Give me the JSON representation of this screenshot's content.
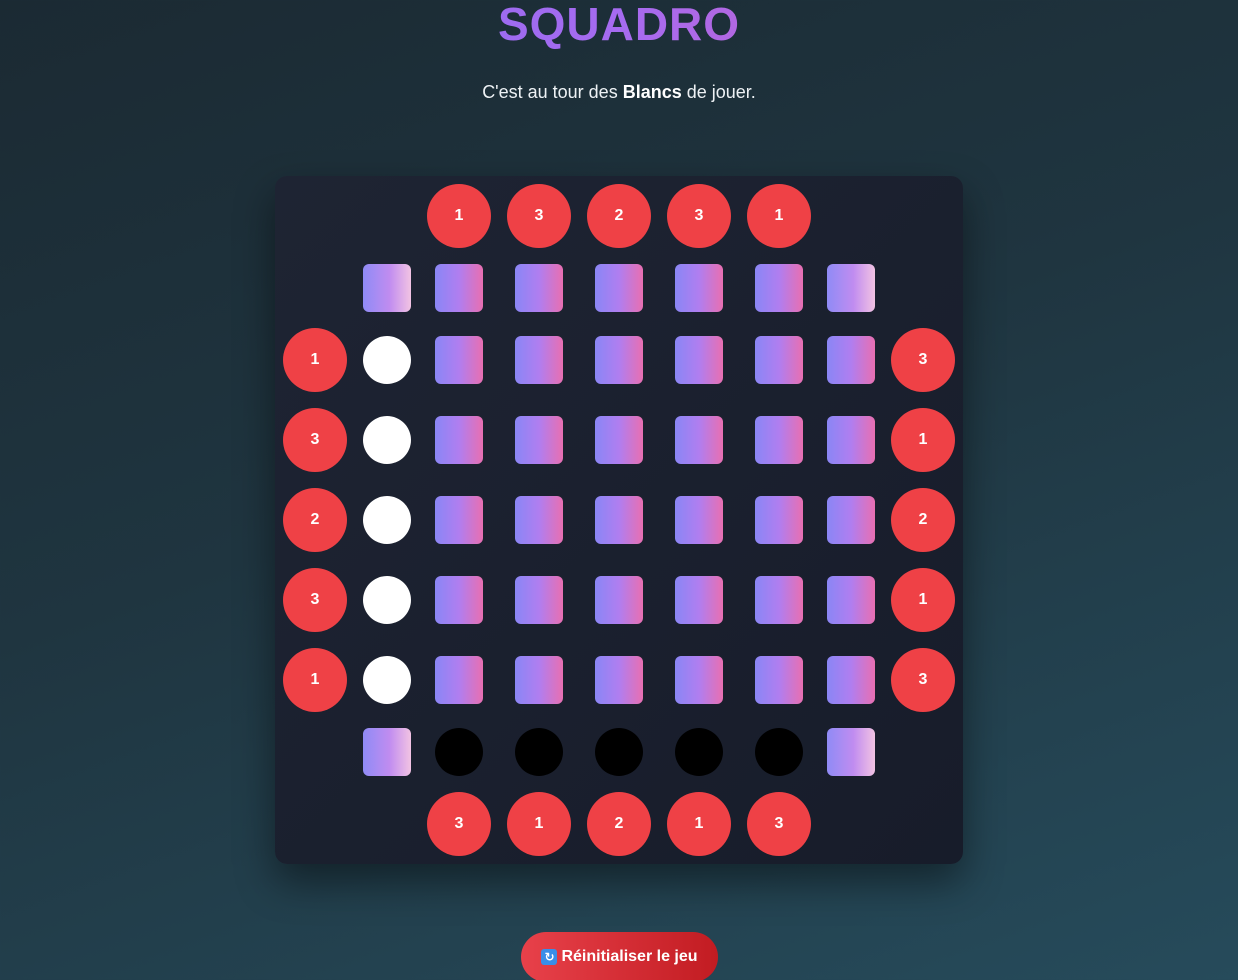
{
  "title": "SQUADRO",
  "status": {
    "prefix": "C'est au tour des ",
    "player": "Blancs",
    "suffix": " de jouer."
  },
  "board": {
    "top_speeds": [
      "1",
      "3",
      "2",
      "3",
      "1"
    ],
    "bottom_speeds": [
      "3",
      "1",
      "2",
      "1",
      "3"
    ],
    "left_speeds": [
      "1",
      "3",
      "2",
      "3",
      "1"
    ],
    "right_speeds": [
      "3",
      "1",
      "2",
      "1",
      "3"
    ],
    "white_pieces": 5,
    "black_pieces": 5
  },
  "reset_button": {
    "icon": "refresh-icon",
    "label": "Réinitialiser le jeu"
  },
  "colors": {
    "speed_marker": "#ef4146",
    "board_bg": "#1b2130",
    "button": "#dc3038"
  }
}
